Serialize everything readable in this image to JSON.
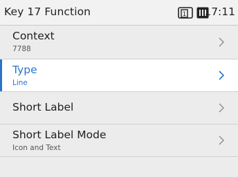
{
  "header": {
    "title": "Key 17 Function",
    "icons": [
      "account-1-icon",
      "battery-icon"
    ],
    "account_number": "1",
    "time": "17:11"
  },
  "menu": {
    "items": [
      {
        "label": "Context",
        "value": "7788",
        "selected": false
      },
      {
        "label": "Type",
        "value": "Line",
        "selected": true
      },
      {
        "label": "Short Label",
        "value": "",
        "selected": false
      },
      {
        "label": "Short Label Mode",
        "value": "Icon and Text",
        "selected": false
      }
    ]
  },
  "colors": {
    "accent": "#2a74c8",
    "background": "#ececec",
    "selected_background": "#ffffff",
    "text": "#1e1e1e"
  }
}
